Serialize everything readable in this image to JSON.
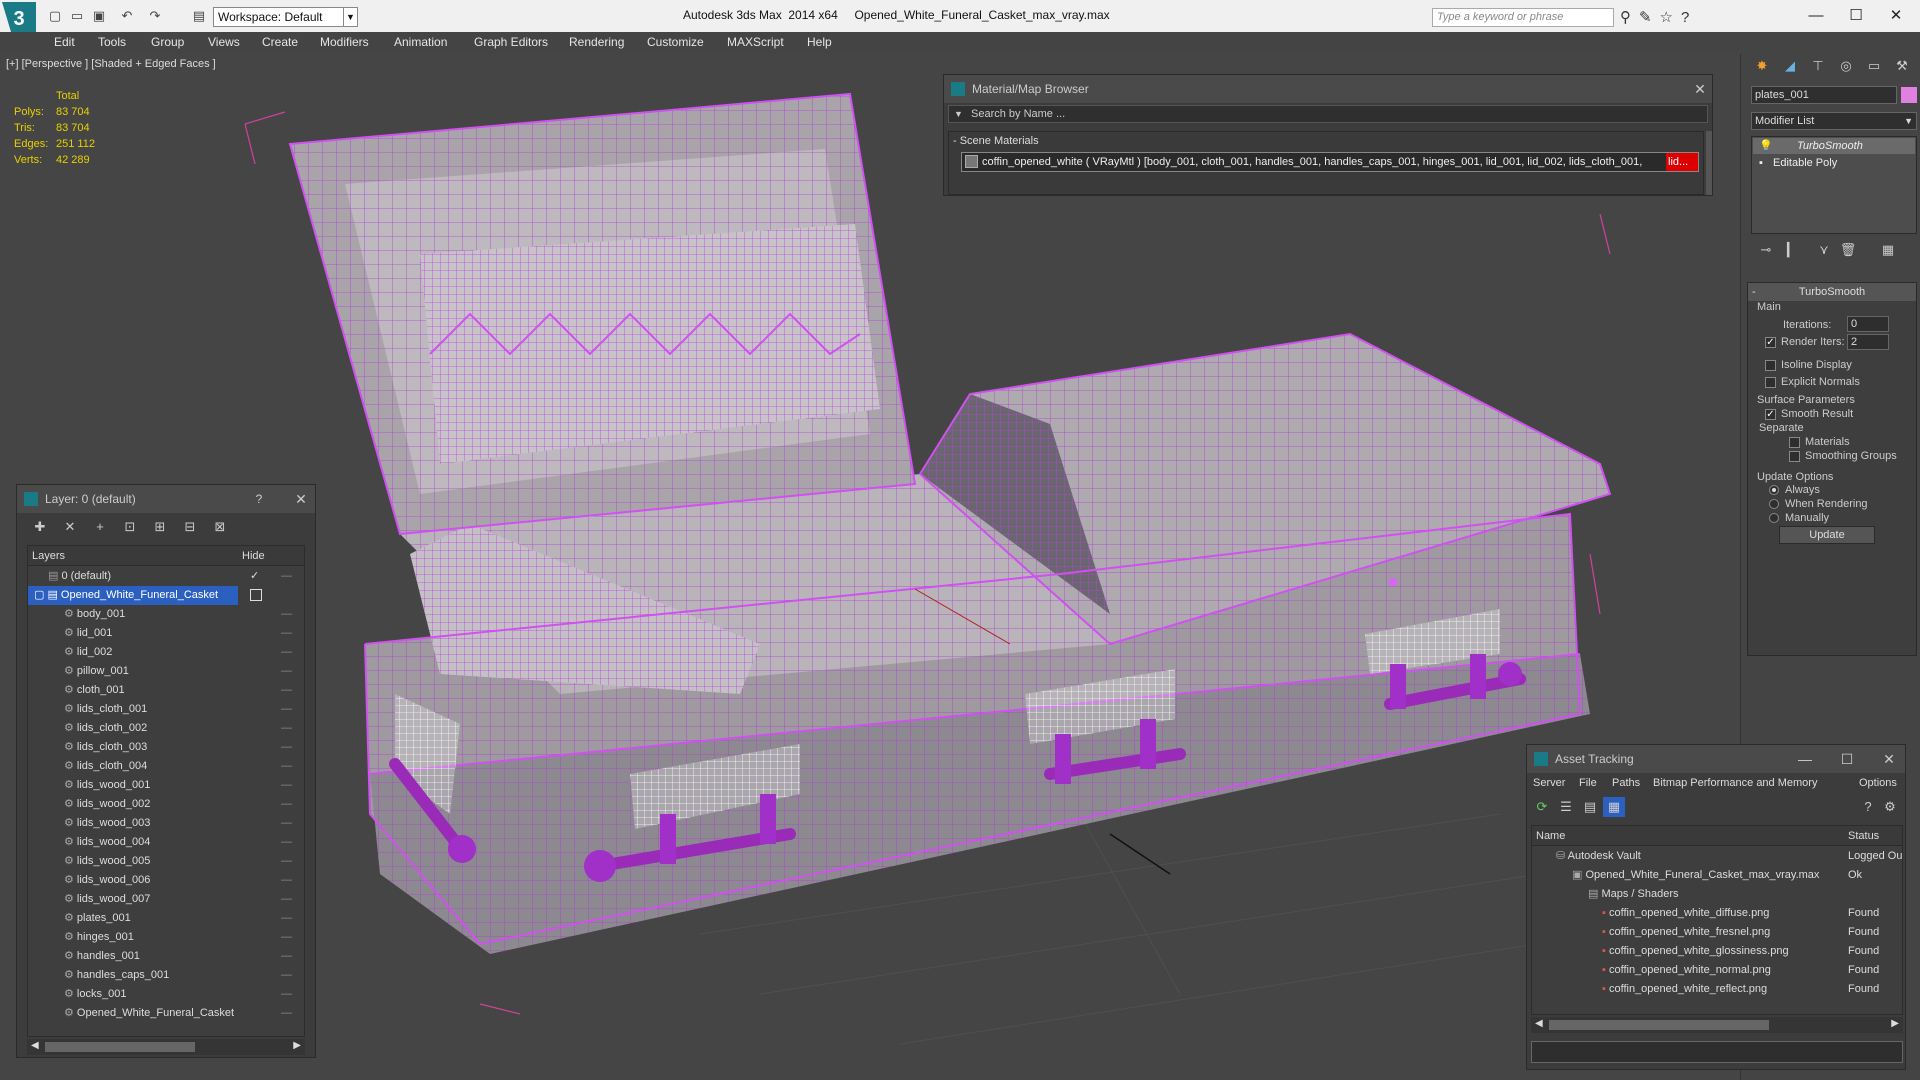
{
  "app": {
    "title": "Autodesk 3ds Max  2014 x64",
    "file": "Opened_White_Funeral_Casket_max_vray.max",
    "workspace": "Workspace: Default",
    "search_placeholder": "Type a keyword or phrase"
  },
  "menu": [
    "Edit",
    "Tools",
    "Group",
    "Views",
    "Create",
    "Modifiers",
    "Animation",
    "Graph Editors",
    "Rendering",
    "Customize",
    "MAXScript",
    "Help"
  ],
  "viewport": {
    "label": "[+] [Perspective ] [Shaded + Edged Faces ]",
    "stats": {
      "header": "Total",
      "rows": [
        {
          "label": "Polys:",
          "value": "83 704"
        },
        {
          "label": "Tris:",
          "value": "83 704"
        },
        {
          "label": "Edges:",
          "value": "251 112"
        },
        {
          "label": "Verts:",
          "value": "42 289"
        }
      ]
    }
  },
  "material_browser": {
    "title": "Material/Map Browser",
    "search": "Search by Name ...",
    "group": "- Scene Materials",
    "item": "coffin_opened_white  ( VRayMtl ) [body_001, cloth_001, handles_001, handles_caps_001, hinges_001, lid_001, lid_002, lids_cloth_001,",
    "item_overflow": "lid..."
  },
  "layer_panel": {
    "title": "Layer: 0 (default)",
    "help": "?",
    "col_layers": "Layers",
    "col_hide": "Hide",
    "default_layer": "0 (default)",
    "selected_layer": "Opened_White_Funeral_Casket",
    "objects": [
      "body_001",
      "lid_001",
      "lid_002",
      "pillow_001",
      "cloth_001",
      "lids_cloth_001",
      "lids_cloth_002",
      "lids_cloth_003",
      "lids_cloth_004",
      "lids_wood_001",
      "lids_wood_002",
      "lids_wood_003",
      "lids_wood_004",
      "lids_wood_005",
      "lids_wood_006",
      "lids_wood_007",
      "plates_001",
      "hinges_001",
      "handles_001",
      "handles_caps_001",
      "locks_001",
      "Opened_White_Funeral_Casket"
    ]
  },
  "command_panel": {
    "object_name": "plates_001",
    "modifier_list": "Modifier List",
    "stack": [
      "TurboSmooth",
      "Editable Poly"
    ],
    "rollout_title": "TurboSmooth",
    "main": "Main",
    "iterations_label": "Iterations:",
    "iterations_value": "0",
    "render_iters_label": "Render Iters:",
    "render_iters_value": "2",
    "isoline": "Isoline Display",
    "explicit_normals": "Explicit Normals",
    "surface_params": "Surface Parameters",
    "smooth_result": "Smooth Result",
    "separate": "Separate",
    "materials": "Materials",
    "smoothing_groups": "Smoothing Groups",
    "update_options": "Update Options",
    "always": "Always",
    "when_rendering": "When Rendering",
    "manually": "Manually",
    "update_btn": "Update"
  },
  "asset_tracking": {
    "title": "Asset Tracking",
    "menu": [
      "Server",
      "File",
      "Paths",
      "Bitmap Performance and Memory",
      "Options"
    ],
    "col_name": "Name",
    "col_status": "Status",
    "rows": [
      {
        "name": "Autodesk Vault",
        "status": "Logged Ou"
      },
      {
        "name": "Opened_White_Funeral_Casket_max_vray.max",
        "status": "Ok"
      },
      {
        "name": "Maps / Shaders",
        "status": ""
      },
      {
        "name": "coffin_opened_white_diffuse.png",
        "status": "Found"
      },
      {
        "name": "coffin_opened_white_fresnel.png",
        "status": "Found"
      },
      {
        "name": "coffin_opened_white_glossiness.png",
        "status": "Found"
      },
      {
        "name": "coffin_opened_white_normal.png",
        "status": "Found"
      },
      {
        "name": "coffin_opened_white_reflect.png",
        "status": "Found"
      }
    ]
  },
  "colors": {
    "wire": "#c040e0",
    "accent": "#1a7a86",
    "selection": "#2b5fc0",
    "stats": "#e8d000"
  }
}
